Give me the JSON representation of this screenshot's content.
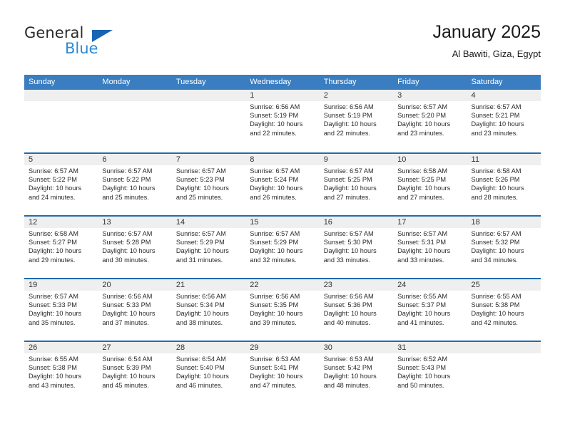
{
  "brand": {
    "name_part1": "General",
    "name_part2": "Blue",
    "color_dark": "#2b2b2b",
    "color_blue": "#2d8ad4",
    "triangle_color": "#1665b3"
  },
  "header": {
    "title": "January 2025",
    "subtitle": "Al Bawiti, Giza, Egypt"
  },
  "theme": {
    "header_bar": "#3a7dc0",
    "row_divider": "#1f6bb0",
    "daynum_band": "#efefef",
    "text": "#2a2a2a"
  },
  "weekdays": [
    "Sunday",
    "Monday",
    "Tuesday",
    "Wednesday",
    "Thursday",
    "Friday",
    "Saturday"
  ],
  "weeks": [
    [
      {
        "empty": true
      },
      {
        "empty": true
      },
      {
        "empty": true
      },
      {
        "day": "1",
        "sunrise": "Sunrise: 6:56 AM",
        "sunset": "Sunset: 5:19 PM",
        "daylight1": "Daylight: 10 hours",
        "daylight2": "and 22 minutes."
      },
      {
        "day": "2",
        "sunrise": "Sunrise: 6:56 AM",
        "sunset": "Sunset: 5:19 PM",
        "daylight1": "Daylight: 10 hours",
        "daylight2": "and 22 minutes."
      },
      {
        "day": "3",
        "sunrise": "Sunrise: 6:57 AM",
        "sunset": "Sunset: 5:20 PM",
        "daylight1": "Daylight: 10 hours",
        "daylight2": "and 23 minutes."
      },
      {
        "day": "4",
        "sunrise": "Sunrise: 6:57 AM",
        "sunset": "Sunset: 5:21 PM",
        "daylight1": "Daylight: 10 hours",
        "daylight2": "and 23 minutes."
      }
    ],
    [
      {
        "day": "5",
        "sunrise": "Sunrise: 6:57 AM",
        "sunset": "Sunset: 5:22 PM",
        "daylight1": "Daylight: 10 hours",
        "daylight2": "and 24 minutes."
      },
      {
        "day": "6",
        "sunrise": "Sunrise: 6:57 AM",
        "sunset": "Sunset: 5:22 PM",
        "daylight1": "Daylight: 10 hours",
        "daylight2": "and 25 minutes."
      },
      {
        "day": "7",
        "sunrise": "Sunrise: 6:57 AM",
        "sunset": "Sunset: 5:23 PM",
        "daylight1": "Daylight: 10 hours",
        "daylight2": "and 25 minutes."
      },
      {
        "day": "8",
        "sunrise": "Sunrise: 6:57 AM",
        "sunset": "Sunset: 5:24 PM",
        "daylight1": "Daylight: 10 hours",
        "daylight2": "and 26 minutes."
      },
      {
        "day": "9",
        "sunrise": "Sunrise: 6:57 AM",
        "sunset": "Sunset: 5:25 PM",
        "daylight1": "Daylight: 10 hours",
        "daylight2": "and 27 minutes."
      },
      {
        "day": "10",
        "sunrise": "Sunrise: 6:58 AM",
        "sunset": "Sunset: 5:25 PM",
        "daylight1": "Daylight: 10 hours",
        "daylight2": "and 27 minutes."
      },
      {
        "day": "11",
        "sunrise": "Sunrise: 6:58 AM",
        "sunset": "Sunset: 5:26 PM",
        "daylight1": "Daylight: 10 hours",
        "daylight2": "and 28 minutes."
      }
    ],
    [
      {
        "day": "12",
        "sunrise": "Sunrise: 6:58 AM",
        "sunset": "Sunset: 5:27 PM",
        "daylight1": "Daylight: 10 hours",
        "daylight2": "and 29 minutes."
      },
      {
        "day": "13",
        "sunrise": "Sunrise: 6:57 AM",
        "sunset": "Sunset: 5:28 PM",
        "daylight1": "Daylight: 10 hours",
        "daylight2": "and 30 minutes."
      },
      {
        "day": "14",
        "sunrise": "Sunrise: 6:57 AM",
        "sunset": "Sunset: 5:29 PM",
        "daylight1": "Daylight: 10 hours",
        "daylight2": "and 31 minutes."
      },
      {
        "day": "15",
        "sunrise": "Sunrise: 6:57 AM",
        "sunset": "Sunset: 5:29 PM",
        "daylight1": "Daylight: 10 hours",
        "daylight2": "and 32 minutes."
      },
      {
        "day": "16",
        "sunrise": "Sunrise: 6:57 AM",
        "sunset": "Sunset: 5:30 PM",
        "daylight1": "Daylight: 10 hours",
        "daylight2": "and 33 minutes."
      },
      {
        "day": "17",
        "sunrise": "Sunrise: 6:57 AM",
        "sunset": "Sunset: 5:31 PM",
        "daylight1": "Daylight: 10 hours",
        "daylight2": "and 33 minutes."
      },
      {
        "day": "18",
        "sunrise": "Sunrise: 6:57 AM",
        "sunset": "Sunset: 5:32 PM",
        "daylight1": "Daylight: 10 hours",
        "daylight2": "and 34 minutes."
      }
    ],
    [
      {
        "day": "19",
        "sunrise": "Sunrise: 6:57 AM",
        "sunset": "Sunset: 5:33 PM",
        "daylight1": "Daylight: 10 hours",
        "daylight2": "and 35 minutes."
      },
      {
        "day": "20",
        "sunrise": "Sunrise: 6:56 AM",
        "sunset": "Sunset: 5:33 PM",
        "daylight1": "Daylight: 10 hours",
        "daylight2": "and 37 minutes."
      },
      {
        "day": "21",
        "sunrise": "Sunrise: 6:56 AM",
        "sunset": "Sunset: 5:34 PM",
        "daylight1": "Daylight: 10 hours",
        "daylight2": "and 38 minutes."
      },
      {
        "day": "22",
        "sunrise": "Sunrise: 6:56 AM",
        "sunset": "Sunset: 5:35 PM",
        "daylight1": "Daylight: 10 hours",
        "daylight2": "and 39 minutes."
      },
      {
        "day": "23",
        "sunrise": "Sunrise: 6:56 AM",
        "sunset": "Sunset: 5:36 PM",
        "daylight1": "Daylight: 10 hours",
        "daylight2": "and 40 minutes."
      },
      {
        "day": "24",
        "sunrise": "Sunrise: 6:55 AM",
        "sunset": "Sunset: 5:37 PM",
        "daylight1": "Daylight: 10 hours",
        "daylight2": "and 41 minutes."
      },
      {
        "day": "25",
        "sunrise": "Sunrise: 6:55 AM",
        "sunset": "Sunset: 5:38 PM",
        "daylight1": "Daylight: 10 hours",
        "daylight2": "and 42 minutes."
      }
    ],
    [
      {
        "day": "26",
        "sunrise": "Sunrise: 6:55 AM",
        "sunset": "Sunset: 5:38 PM",
        "daylight1": "Daylight: 10 hours",
        "daylight2": "and 43 minutes."
      },
      {
        "day": "27",
        "sunrise": "Sunrise: 6:54 AM",
        "sunset": "Sunset: 5:39 PM",
        "daylight1": "Daylight: 10 hours",
        "daylight2": "and 45 minutes."
      },
      {
        "day": "28",
        "sunrise": "Sunrise: 6:54 AM",
        "sunset": "Sunset: 5:40 PM",
        "daylight1": "Daylight: 10 hours",
        "daylight2": "and 46 minutes."
      },
      {
        "day": "29",
        "sunrise": "Sunrise: 6:53 AM",
        "sunset": "Sunset: 5:41 PM",
        "daylight1": "Daylight: 10 hours",
        "daylight2": "and 47 minutes."
      },
      {
        "day": "30",
        "sunrise": "Sunrise: 6:53 AM",
        "sunset": "Sunset: 5:42 PM",
        "daylight1": "Daylight: 10 hours",
        "daylight2": "and 48 minutes."
      },
      {
        "day": "31",
        "sunrise": "Sunrise: 6:52 AM",
        "sunset": "Sunset: 5:43 PM",
        "daylight1": "Daylight: 10 hours",
        "daylight2": "and 50 minutes."
      },
      {
        "empty": true
      }
    ]
  ]
}
